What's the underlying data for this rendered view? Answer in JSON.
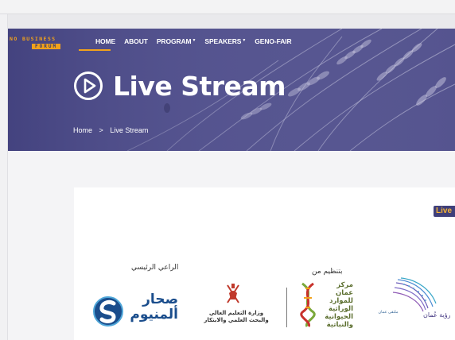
{
  "header": {
    "logo_row1": "NO BUSINESS",
    "logo_row2": "FORUM",
    "nav": [
      {
        "label": "HOME",
        "has_dropdown": false
      },
      {
        "label": "ABOUT",
        "has_dropdown": false
      },
      {
        "label": "PROGRAM",
        "has_dropdown": true
      },
      {
        "label": "SPEAKERS",
        "has_dropdown": true
      },
      {
        "label": "GENO-FAIR",
        "has_dropdown": false
      }
    ]
  },
  "hero": {
    "title": "Live Stream",
    "title_icon": "play-circle-icon",
    "breadcrumb": {
      "home": "Home",
      "separator": ">",
      "current": "Live Stream"
    }
  },
  "main": {
    "live_badge": "Live",
    "sponsor_label": "الراعي الرئيسي",
    "organizer_label": "بتنظيم من",
    "sohar": {
      "line1": "صحار",
      "line2": "ألمنيوم"
    },
    "ministry": {
      "line1": "وزارة التعليم العالي",
      "line2": "والبحث العلمي والابتكار"
    },
    "genres": {
      "lines": [
        "مركز",
        "عمان",
        "للموارد",
        "الوراثية",
        "الحيوانية",
        "والنباتية"
      ]
    },
    "partner_small": "ملتقى عمان",
    "vision_text": "رؤية عُمان"
  },
  "colors": {
    "accent": "#f2a21b",
    "hero_purple": "#4b4a86",
    "badge_bg": "#3f3f7a",
    "sohar_blue": "#1a4d8c"
  }
}
